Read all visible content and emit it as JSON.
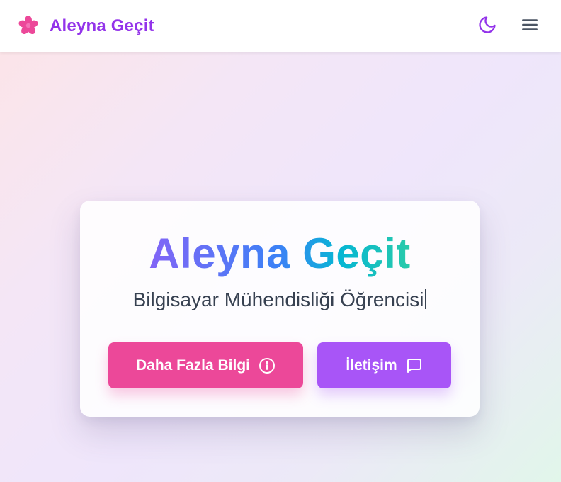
{
  "navbar": {
    "brand_name": "Aleyna Geçit",
    "logo_icon": "flower-asterisk-icon",
    "theme_toggle_icon": "moon-icon",
    "menu_icon": "hamburger-menu-icon"
  },
  "hero": {
    "title_part1": "Aleyna",
    "title_part2": "Geçit",
    "subtitle": "Bilgisayar Mühendisliği Öğrencisi",
    "buttons": {
      "more_info_label": "Daha Fazla Bilgi",
      "more_info_icon": "info-circle-icon",
      "contact_label": "İletişim",
      "contact_icon": "message-square-icon"
    }
  },
  "colors": {
    "brand": "#9333ea",
    "logo": "#ec4899",
    "primary_button": "#ec4899",
    "secondary_button": "#a855f7",
    "title_gradient": [
      "#a855f7",
      "#3b82f6",
      "#06b6d4",
      "#4ade80"
    ]
  }
}
